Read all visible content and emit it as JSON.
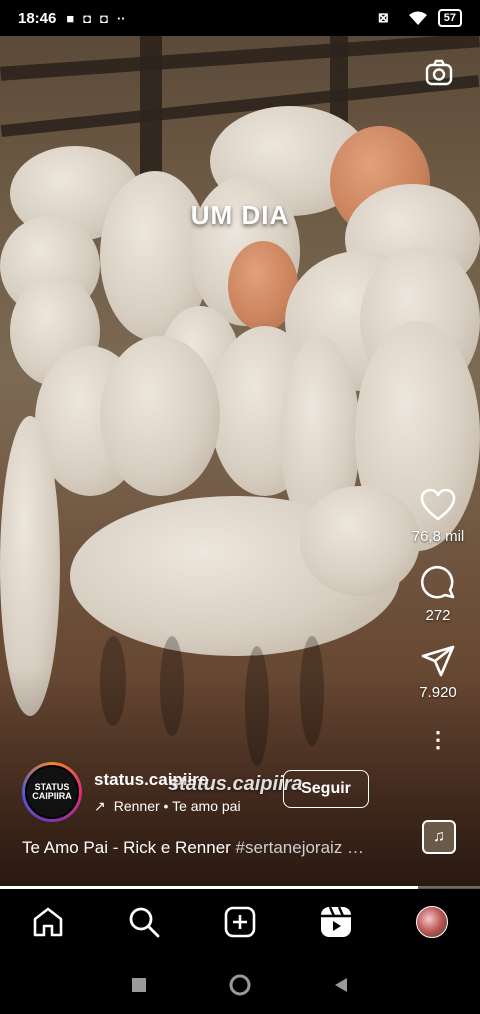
{
  "status_bar": {
    "time": "18:46",
    "battery": "57"
  },
  "reel": {
    "overlay_text": "UM DIA",
    "likes": "76,8 mil",
    "comments": "272",
    "shares": "7.920",
    "progress_fraction": 0.87
  },
  "author": {
    "username": "status.caipiire",
    "avatar_text": "STATUS CAIPIIRA",
    "music": "Renner • Te amo pai",
    "watermark": "status.caipiira",
    "follow_label": "Seguir"
  },
  "caption": {
    "text": "Te Amo Pai - Rick e Renner ",
    "hashtag": "#sertanejoraiz …"
  },
  "icons": {
    "camera": "camera-icon",
    "like": "heart-icon",
    "comment": "comment-icon",
    "share": "send-icon",
    "more": "more-icon",
    "home": "home-icon",
    "search": "search-icon",
    "create": "plus-icon",
    "reels": "reels-icon"
  }
}
